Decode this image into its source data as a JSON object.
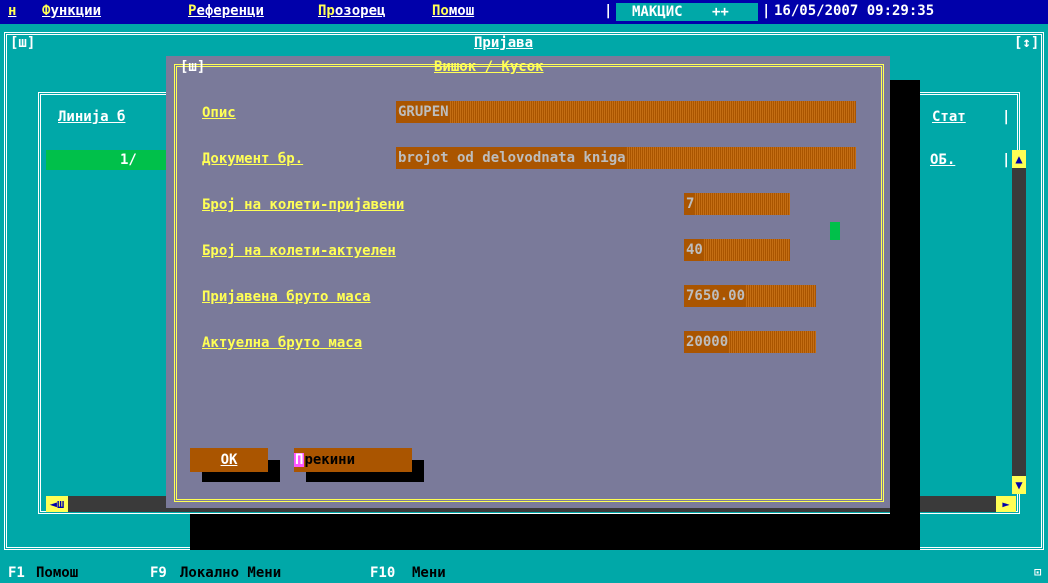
{
  "menu": {
    "items": [
      {
        "hot": "н",
        "rest": ""
      },
      {
        "hot": "Ф",
        "rest": "ункции"
      },
      {
        "hot": "Р",
        "rest": "еференци"
      },
      {
        "hot": "Пр",
        "rest": "озорец"
      },
      {
        "hot": "По",
        "rest": "мош"
      }
    ],
    "brand": "МАКЦИС",
    "brand_suffix": "++",
    "datetime": "16/05/2007 09:29:35"
  },
  "main_window": {
    "title": "Пријава",
    "sysbox": "[ш]",
    "zoom": "[↕]",
    "grid": {
      "col_line": "Линија б",
      "col_stat": "Стат",
      "row_line": "1/",
      "row_stat": "ОБ."
    },
    "scroll": {
      "up": "▲",
      "down": "▼",
      "left": "◄",
      "right": "►",
      "left_label": "ш"
    }
  },
  "dialog": {
    "title": "Вишок / Кусок",
    "sysbox": "[ш]",
    "fields": [
      {
        "label": "Опис",
        "value": "GRUPEN"
      },
      {
        "label": "Документ бр.",
        "value": "brojot od delovodnata kniga"
      },
      {
        "label": "Број на колети-пријавени",
        "value": "7"
      },
      {
        "label": "Број на колети-актуелен",
        "value": "40"
      },
      {
        "label": "Пријавена бруто маса",
        "value": "7650.00"
      },
      {
        "label": "Актуелна бруто маса",
        "value": "20000"
      }
    ],
    "ok_label": "OK",
    "cancel_hot": "П",
    "cancel_rest": "рекини"
  },
  "statusbar": {
    "f1_key": "F1",
    "f1_desc": "Помош",
    "f9_key": "F9",
    "f9_desc": "Локално Мени",
    "f10_key": "F10",
    "f10_desc": "Мени",
    "icon": "⊡"
  },
  "colors": {
    "teal": "#00a8a8",
    "blue": "#0000aa",
    "yellow": "#ffff55",
    "dialog_gray": "#7a7a9a",
    "field_brown": "#aa5500",
    "row_green": "#00c04a"
  }
}
